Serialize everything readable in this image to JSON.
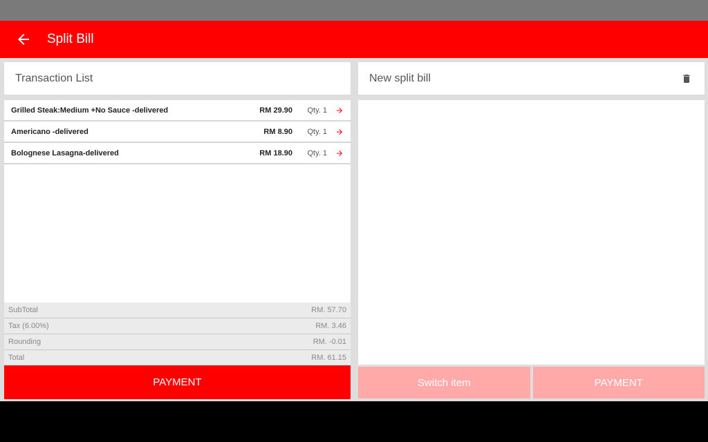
{
  "app_bar": {
    "title": "Split Bill",
    "back_icon": "arrow-left-icon",
    "color": "#ff0000"
  },
  "left_panel": {
    "header": "Transaction List",
    "items": [
      {
        "name": "Grilled Steak:Medium  +No Sauce -delivered",
        "price": "RM 29.90",
        "qty": "Qty. 1"
      },
      {
        "name": "Americano  -delivered",
        "price": "RM 8.90",
        "qty": "Qty. 1"
      },
      {
        "name": "Bolognese Lasagna-delivered",
        "price": "RM 18.90",
        "qty": "Qty. 1"
      }
    ],
    "totals": [
      {
        "label": "SubTotal",
        "value": "RM. 57.70"
      },
      {
        "label": "Tax (6.00%)",
        "value": "RM. 3.46"
      },
      {
        "label": "Rounding",
        "value": "RM. -0.01"
      },
      {
        "label": "Total",
        "value": "RM. 61.15"
      }
    ],
    "payment_label": "PAYMENT"
  },
  "right_panel": {
    "header": "New split bill",
    "delete_icon": "trash-icon",
    "switch_label": "Switch item",
    "payment_label": "PAYMENT",
    "disabled_color": "#ffa9a9"
  }
}
